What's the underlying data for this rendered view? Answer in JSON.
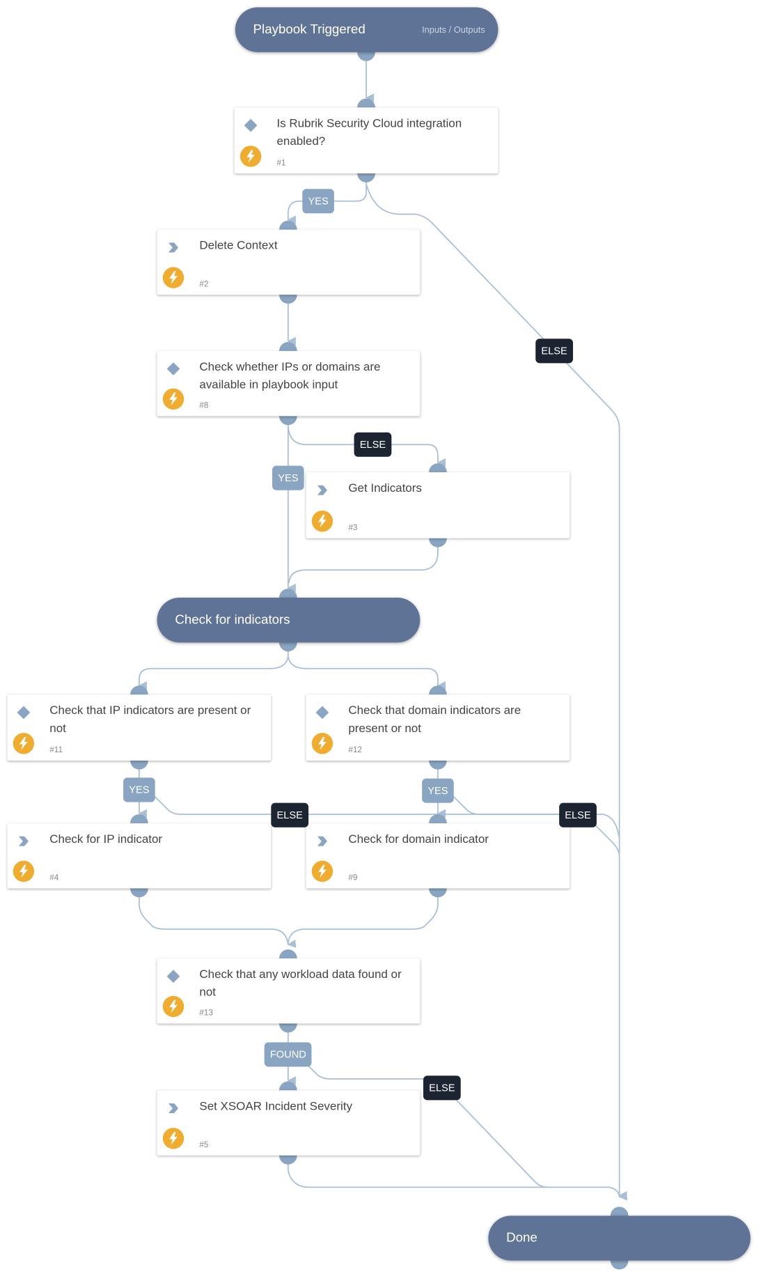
{
  "start": {
    "title": "Playbook Triggered",
    "io_label": "Inputs / Outputs"
  },
  "section": {
    "title": "Check for indicators"
  },
  "done": {
    "title": "Done"
  },
  "tasks": {
    "t1": {
      "title": "Is Rubrik Security Cloud integration enabled?",
      "num": "#1",
      "type": "condition"
    },
    "t2": {
      "title": "Delete Context",
      "num": "#2",
      "type": "command"
    },
    "t8": {
      "title": "Check whether IPs or domains are available in playbook input",
      "num": "#8",
      "type": "condition"
    },
    "t3": {
      "title": "Get Indicators",
      "num": "#3",
      "type": "command"
    },
    "t11": {
      "title": "Check that IP indicators are present or not",
      "num": "#11",
      "type": "condition"
    },
    "t12": {
      "title": "Check that domain indicators are present or not",
      "num": "#12",
      "type": "condition"
    },
    "t4": {
      "title": "Check for IP indicator",
      "num": "#4",
      "type": "command"
    },
    "t9": {
      "title": "Check for domain indicator",
      "num": "#9",
      "type": "command"
    },
    "t13": {
      "title": "Check that any workload data found or not",
      "num": "#13",
      "type": "condition"
    },
    "t5": {
      "title": "Set XSOAR Incident Severity",
      "num": "#5",
      "type": "command"
    }
  },
  "labels": {
    "yes": "YES",
    "else": "ELSE",
    "found": "FOUND"
  },
  "colors": {
    "pill": "#5f7396",
    "port": "#89a5c2",
    "edge": "#a9bfd6",
    "yes_badge": "#89a5c2",
    "else_badge": "#1c2331",
    "automation": "#f0ac2f"
  }
}
